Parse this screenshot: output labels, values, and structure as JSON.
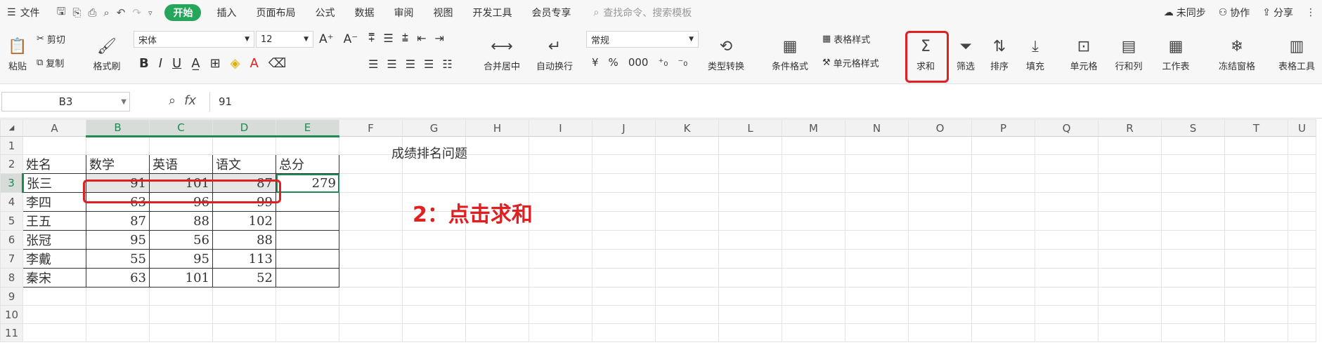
{
  "menubar": {
    "file": "文件",
    "tabs": [
      "开始",
      "插入",
      "页面布局",
      "公式",
      "数据",
      "审阅",
      "视图",
      "开发工具",
      "会员专享"
    ],
    "search_placeholder": "查找命令、搜索模板",
    "sync": "未同步",
    "collab": "协作",
    "share": "分享"
  },
  "ribbon": {
    "paste": "粘贴",
    "cut": "剪切",
    "copy": "复制",
    "format_painter": "格式刷",
    "font_name": "宋体",
    "font_size": "12",
    "merge_center": "合并居中",
    "wrap_text": "自动换行",
    "number_format": "常规",
    "type_convert": "类型转换",
    "cond_format": "条件格式",
    "table_style": "表格样式",
    "cell_style": "单元格样式",
    "sum": "求和",
    "filter": "筛选",
    "sort": "排序",
    "fill": "填充",
    "cell": "单元格",
    "row_col": "行和列",
    "worksheet": "工作表",
    "freeze": "冻结窗格",
    "table_tools": "表格工具",
    "currency": "¥",
    "percent": "%",
    "thousands": "000"
  },
  "formula_bar": {
    "name_box": "B3",
    "fx": "fx",
    "value": "91"
  },
  "sheet": {
    "columns": [
      "A",
      "B",
      "C",
      "D",
      "E",
      "F",
      "G",
      "H",
      "I",
      "J",
      "K",
      "L",
      "M",
      "N",
      "O",
      "P",
      "Q",
      "R",
      "S",
      "T",
      "U"
    ],
    "title": "成绩排名问题",
    "headers": [
      "姓名",
      "数学",
      "英语",
      "语文",
      "总分"
    ],
    "rows": [
      [
        "张三",
        "91",
        "101",
        "87",
        "279"
      ],
      [
        "李四",
        "63",
        "96",
        "99",
        ""
      ],
      [
        "王五",
        "87",
        "88",
        "102",
        ""
      ],
      [
        "张冠",
        "95",
        "56",
        "88",
        ""
      ],
      [
        "李戴",
        "55",
        "95",
        "113",
        ""
      ],
      [
        "秦宋",
        "63",
        "101",
        "52",
        ""
      ]
    ],
    "row_numbers": [
      "1",
      "2",
      "3",
      "4",
      "5",
      "6",
      "7",
      "8",
      "9",
      "10",
      "11"
    ]
  },
  "annotation": "2：点击求和",
  "colors": {
    "accent": "#25a65b",
    "highlight": "#e02020"
  }
}
